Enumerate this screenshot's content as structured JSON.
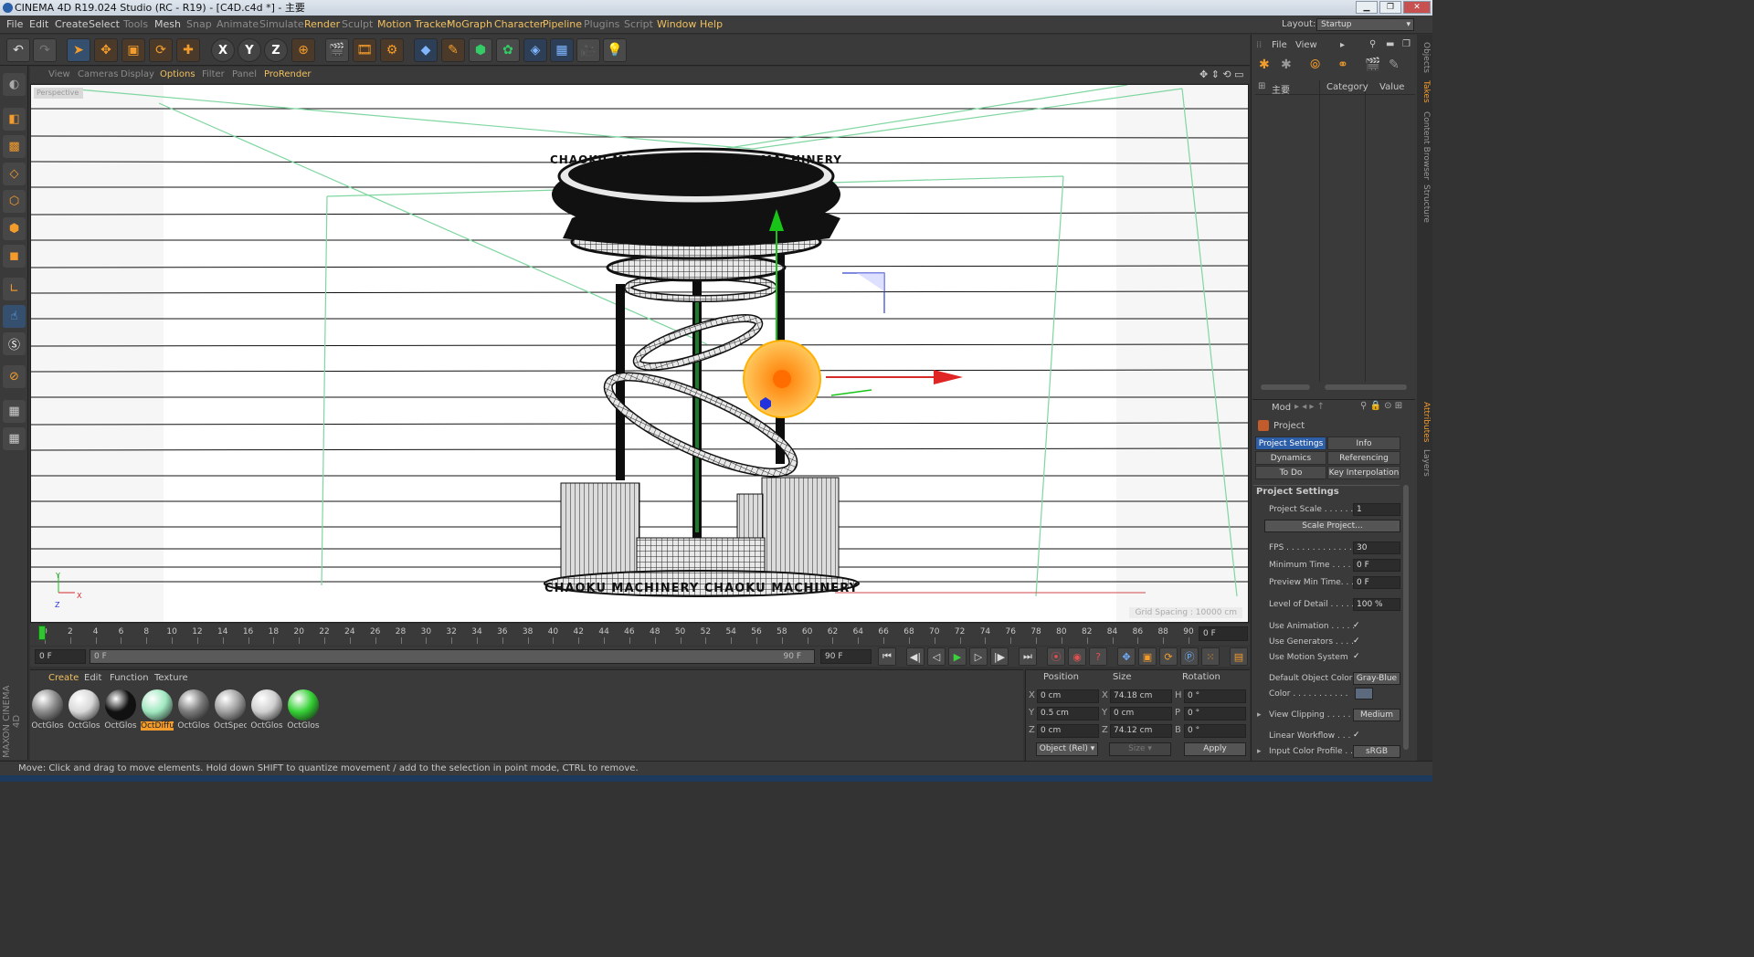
{
  "window": {
    "title": "CINEMA 4D R19.024 Studio (RC - R19) - [C4D.c4d *] - 主要",
    "layout_label": "Layout:",
    "layout_value": "Startup"
  },
  "menubar": [
    "File",
    "Edit",
    "Create",
    "Select",
    "Tools",
    "Mesh",
    "Snap",
    "Animate",
    "Simulate",
    "Render",
    "Sculpt",
    "Motion Tracker",
    "MoGraph",
    "Character",
    "Pipeline",
    "Plugins",
    "Script",
    "Window",
    "Help"
  ],
  "viewport": {
    "menu": [
      "View",
      "Cameras",
      "Display",
      "Options",
      "Filter",
      "Panel",
      "ProRender"
    ],
    "grid_label": "Grid Spacing : 10000 cm",
    "corner_label": "Perspective",
    "sign_text": "CHAOKU MACHINERY  CHAOKU MACHINERY",
    "axis": {
      "x": "X",
      "y": "Y",
      "z": "Z"
    }
  },
  "timeline": {
    "ticks": [
      "0",
      "2",
      "4",
      "6",
      "8",
      "10",
      "12",
      "14",
      "16",
      "18",
      "20",
      "22",
      "24",
      "26",
      "28",
      "30",
      "32",
      "34",
      "36",
      "38",
      "40",
      "42",
      "44",
      "46",
      "48",
      "50",
      "52",
      "54",
      "56",
      "58",
      "60",
      "62",
      "64",
      "66",
      "68",
      "70",
      "72",
      "74",
      "76",
      "78",
      "80",
      "82",
      "84",
      "86",
      "88",
      "90"
    ],
    "current_frame": "0 F",
    "start": "0 F",
    "slider_start": "0 F",
    "slider_end": "90 F",
    "end": "90 F"
  },
  "materials": {
    "menu": [
      "Create",
      "Edit",
      "Function",
      "Texture"
    ],
    "items": [
      {
        "label": "OctGlos",
        "color": "#8a8a8a"
      },
      {
        "label": "OctGlos",
        "color": "#d8d8d8"
      },
      {
        "label": "OctGlos",
        "color": "#111111"
      },
      {
        "label": "OctDiffu",
        "color": "#9fe8c0",
        "selected": true
      },
      {
        "label": "OctGlos",
        "color": "#7a7a7a"
      },
      {
        "label": "OctSpec",
        "color": "#a0a0a0"
      },
      {
        "label": "OctGlos",
        "color": "#cfcfcf"
      },
      {
        "label": "OctGlos",
        "color": "#35d135"
      }
    ]
  },
  "coordinates": {
    "headers": {
      "position": "Position",
      "size": "Size",
      "rotation": "Rotation"
    },
    "rows": [
      {
        "axis": "X",
        "pos": "0 cm",
        "size_axis": "X",
        "size": "74.18 cm",
        "rot_axis": "H",
        "rot": "0 °"
      },
      {
        "axis": "Y",
        "pos": "0.5 cm",
        "size_axis": "Y",
        "size": "0 cm",
        "rot_axis": "P",
        "rot": "0 °"
      },
      {
        "axis": "Z",
        "pos": "0 cm",
        "size_axis": "Z",
        "size": "74.12 cm",
        "rot_axis": "B",
        "rot": "0 °"
      }
    ],
    "mode": "Object (Rel)",
    "size_mode": "Size",
    "apply": "Apply"
  },
  "status": "Move: Click and drag to move elements. Hold down SHIFT to quantize movement / add to the selection in point mode, CTRL to remove.",
  "objects": {
    "menu": [
      "File",
      "View"
    ],
    "tree_item": "主要",
    "columns": [
      "Category",
      "Value"
    ]
  },
  "attributes": {
    "mode_label": "Mod",
    "object": "Project",
    "tabs": [
      "Project Settings",
      "Info",
      "Dynamics",
      "Referencing",
      "To Do",
      "Key Interpolation"
    ],
    "section": "Project Settings",
    "rows": [
      {
        "label": "Project Scale . . . . . .",
        "value": "1"
      },
      {
        "label": "FPS . . . . . . . . . . . . . .",
        "value": "30"
      },
      {
        "label": "Minimum Time . . . . .",
        "value": "0 F"
      },
      {
        "label": "Preview Min Time. . .",
        "value": "0 F"
      },
      {
        "label": "Level of Detail . . . . .",
        "value": "100 %"
      },
      {
        "label": "Use Animation . . . . .",
        "value": "✓"
      },
      {
        "label": "Use Generators . . . .",
        "value": "✓"
      },
      {
        "label": "Use Motion System",
        "value": "✓"
      },
      {
        "label": "Default Object Color",
        "value": "Gray-Blue"
      },
      {
        "label": "Color . . . . . . . . . . .",
        "value": ""
      },
      {
        "label": "View Clipping . . . . .",
        "value": "Medium"
      },
      {
        "label": "Linear Workflow . . .",
        "value": "✓"
      },
      {
        "label": "Input Color Profile . .",
        "value": "sRGB"
      }
    ],
    "scale_button": "Scale Project..."
  },
  "side_tabs": [
    "Objects",
    "Takes",
    "Content Browser",
    "Structure",
    "Attributes",
    "Layers"
  ],
  "brand": "MAXON CINEMA 4D",
  "colors": {
    "accent": "#f39c2c",
    "selected_tab": "#2d5ea8",
    "playhead": "#31c631"
  }
}
